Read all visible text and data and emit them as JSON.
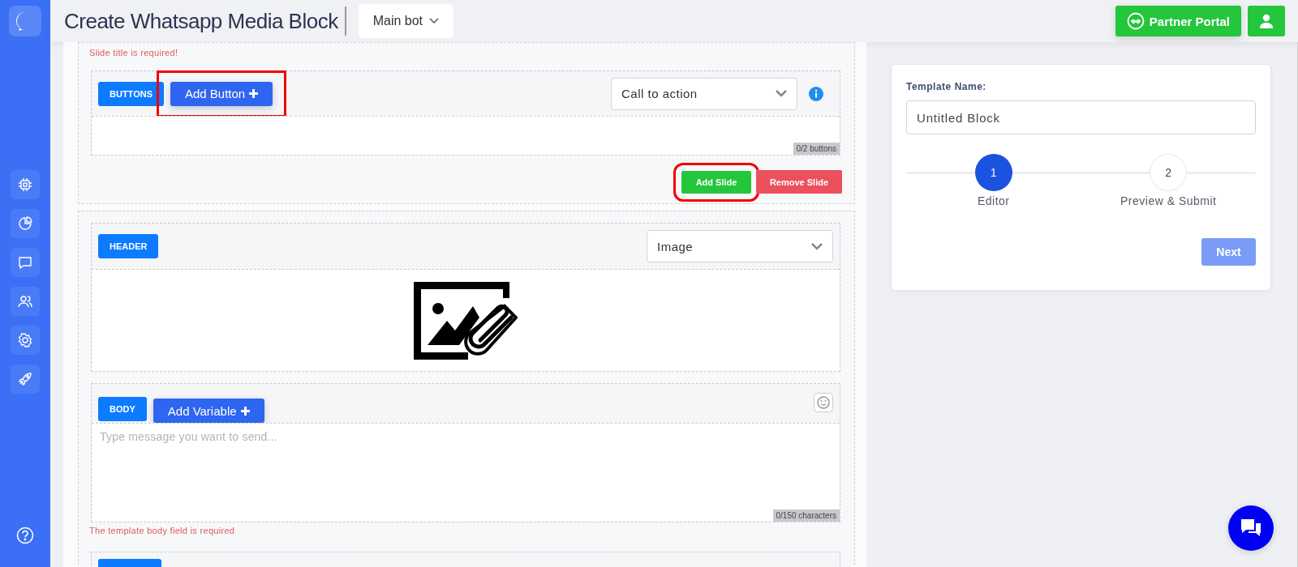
{
  "topbar": {
    "title": "Create Whatsapp Media Block",
    "bot_selector": "Main bot",
    "partner_button": "Partner Portal"
  },
  "slides": [
    {
      "title_error": "Slide title is required!",
      "sections": [
        {
          "kind": "buttons",
          "label": "BUTTONS",
          "add_button": {
            "label": "Add Button",
            "highlighted": true
          },
          "select": "Call to action",
          "counter": "0/2 buttons"
        }
      ],
      "actions": [
        {
          "kind": "add",
          "label": "Add Slide",
          "highlighted": true
        },
        {
          "kind": "remove",
          "label": "Remove Slide",
          "highlighted": false
        }
      ]
    },
    {
      "sections": [
        {
          "kind": "header",
          "label": "HEADER",
          "select": "Image"
        },
        {
          "kind": "body",
          "label": "BODY",
          "add_button": {
            "label": "Add Variable",
            "highlighted": false
          },
          "placeholder": "Type message you want to send...",
          "counter": "0/150 characters",
          "error": "The template body field is required"
        },
        {
          "kind": "cut-off"
        }
      ]
    }
  ],
  "template_panel": {
    "label": "Template Name:",
    "value": "Untitled Block",
    "steps": [
      {
        "number": "1",
        "label": "Editor",
        "selected": true
      },
      {
        "number": "2",
        "label": "Preview & Submit",
        "selected": false
      }
    ],
    "next_button": {
      "label": "Next",
      "disabled": true
    }
  }
}
